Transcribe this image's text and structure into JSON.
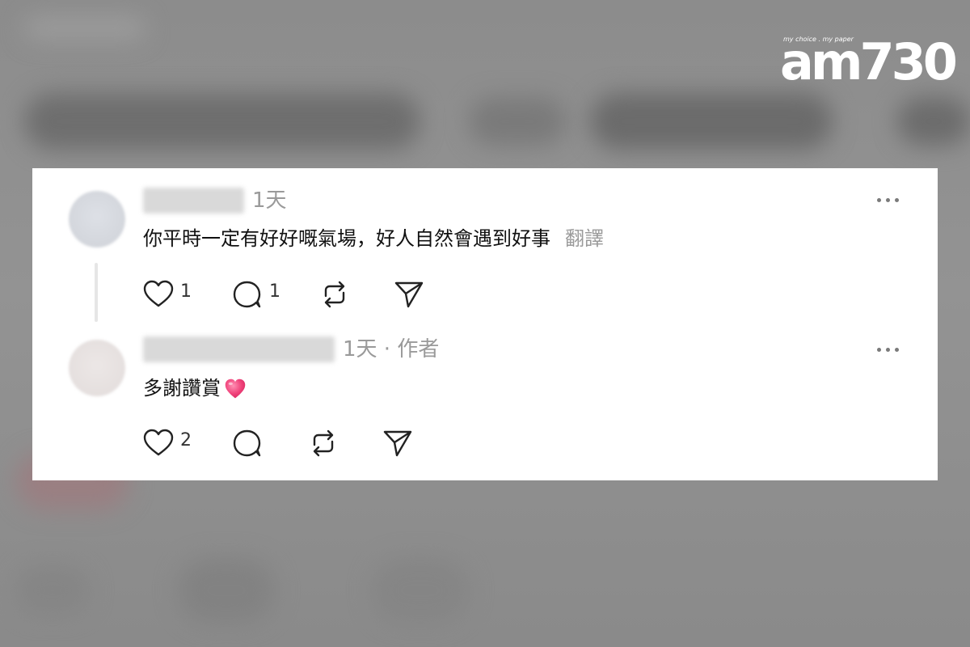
{
  "branding": {
    "logo_text": "am730",
    "tagline": "my choice . my paper"
  },
  "comments": [
    {
      "time": "1天",
      "author_tag": "",
      "text": "你平時一定有好好嘅氣場，好人自然會遇到好事",
      "translate_label": "翻譯",
      "emoji": "",
      "likes": "1",
      "replies": "1",
      "icons": [
        "heart-icon",
        "comment-icon",
        "repost-icon",
        "share-icon"
      ]
    },
    {
      "time": "1天 · 作者",
      "text": "多謝讚賞",
      "translate_label": "",
      "emoji": "pink-heart-emoji",
      "likes": "2",
      "replies": "",
      "icons": [
        "heart-icon",
        "comment-icon",
        "repost-icon",
        "share-icon"
      ]
    }
  ],
  "colors": {
    "heart_emoji": "#f0427a",
    "meta_gray": "#9a9a9a",
    "text": "#111111"
  }
}
